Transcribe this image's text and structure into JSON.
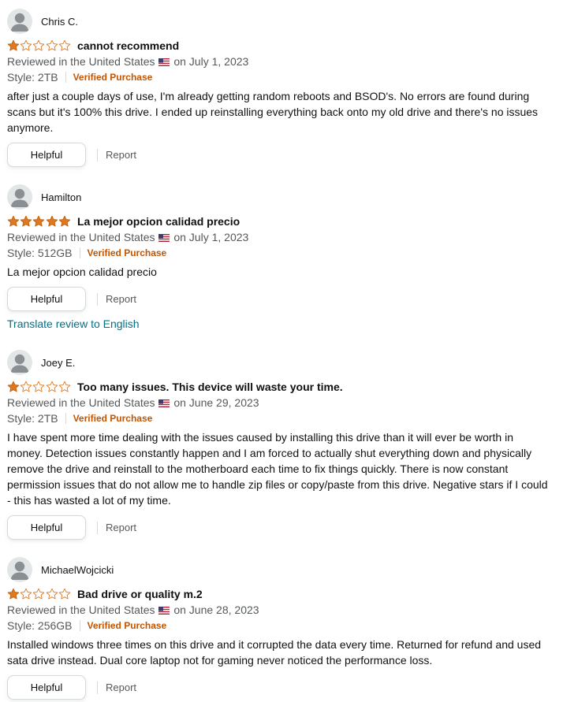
{
  "colors": {
    "star_fill": "#de7921",
    "verified": "#c45500",
    "link": "#007185",
    "muted": "#565959"
  },
  "icons": {
    "avatar": "default-user-avatar-icon",
    "star_filled": "star-filled-icon",
    "star_empty": "star-empty-icon",
    "flag": "us-flag-icon"
  },
  "reviews": [
    {
      "author": "Chris C.",
      "rating": 1,
      "title": "cannot recommend",
      "reviewed_prefix": "Reviewed in the United States",
      "reviewed_date": "on July 1, 2023",
      "style": "Style: 2TB",
      "verified": "Verified Purchase",
      "body": "after just a couple days of use, I'm already getting random reboots and BSOD's. No errors are found during scans but it's 100% this drive. I ended up reinstalling everything back onto my old drive and there's no issues anymore.",
      "helpful": "Helpful",
      "report": "Report"
    },
    {
      "author": "Hamilton",
      "rating": 5,
      "title": "La mejor opcion calidad precio",
      "reviewed_prefix": "Reviewed in the United States",
      "reviewed_date": "on July 1, 2023",
      "style": "Style: 512GB",
      "verified": "Verified Purchase",
      "body": "La mejor opcion calidad precio",
      "helpful": "Helpful",
      "report": "Report",
      "translate": "Translate review to English"
    },
    {
      "author": "Joey E.",
      "rating": 1,
      "title": "Too many issues. This device will waste your time.",
      "reviewed_prefix": "Reviewed in the United States",
      "reviewed_date": "on June 29, 2023",
      "style": "Style: 2TB",
      "verified": "Verified Purchase",
      "body": "I have spent more time dealing with the issues caused by installing this drive than it will ever be worth in money. Detection issues constantly happen and I am forced to actually shut everything down and physically remove the drive and reinstall to the motherboard each time to fix things quickly. There is now constant permission issues that do not allow me to handle zip files or copy/paste from this drive. Negative stars if I could - this has wasted a lot of my time.",
      "helpful": "Helpful",
      "report": "Report"
    },
    {
      "author": "MichaelWojcicki",
      "rating": 1,
      "title": "Bad drive or quality m.2",
      "reviewed_prefix": "Reviewed in the United States",
      "reviewed_date": "on June 28, 2023",
      "style": "Style: 256GB",
      "verified": "Verified Purchase",
      "body": "Installed windows three times on this drive and it corrupted the data every time. Returned for refund and used sata drive instead. Dual core laptop not for gaming never noticed the performance loss.",
      "helpful": "Helpful",
      "report": "Report"
    }
  ]
}
